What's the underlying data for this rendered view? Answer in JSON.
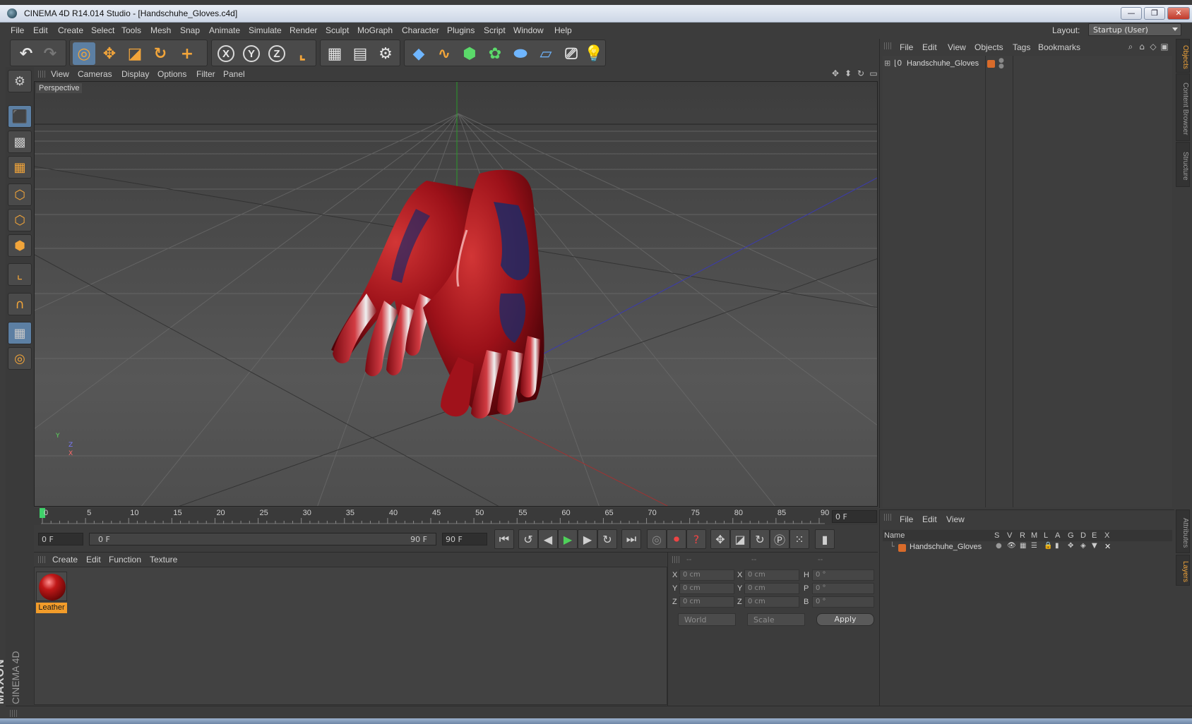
{
  "window": {
    "title": "CINEMA 4D R14.014 Studio - [Handschuhe_Gloves.c4d]",
    "minimize": "—",
    "restore": "❐",
    "close": "✕"
  },
  "menu": [
    "File",
    "Edit",
    "Create",
    "Select",
    "Tools",
    "Mesh",
    "Snap",
    "Animate",
    "Simulate",
    "Render",
    "Sculpt",
    "MoGraph",
    "Character",
    "Plugins",
    "Script",
    "Window",
    "Help"
  ],
  "layout": {
    "label": "Layout:",
    "value": "Startup (User)"
  },
  "toolbar": {
    "axis_x": "X",
    "axis_y": "Y",
    "axis_z": "Z"
  },
  "viewport": {
    "menu": [
      "View",
      "Cameras",
      "Display",
      "Options",
      "Filter",
      "Panel"
    ],
    "label": "Perspective",
    "axis_y": "Y",
    "axis_z": "Z",
    "axis_x": "X"
  },
  "timeline": {
    "ticks": [
      "0",
      "5",
      "10",
      "15",
      "20",
      "25",
      "30",
      "35",
      "40",
      "45",
      "50",
      "55",
      "60",
      "65",
      "70",
      "75",
      "80",
      "85",
      "90"
    ],
    "current_frame": "0 F"
  },
  "playbar": {
    "start_field": "0 F",
    "range_start": "0 F",
    "range_end": "90 F",
    "end_field": "90 F"
  },
  "materials": {
    "menu": [
      "Create",
      "Edit",
      "Function",
      "Texture"
    ],
    "items": [
      {
        "name": "Leather"
      }
    ]
  },
  "coordinates": {
    "headers": [
      "--",
      "--",
      "--"
    ],
    "rows": [
      {
        "l1": "X",
        "v1": "0 cm",
        "l2": "X",
        "v2": "0 cm",
        "l3": "H",
        "v3": "0 °"
      },
      {
        "l1": "Y",
        "v1": "0 cm",
        "l2": "Y",
        "v2": "0 cm",
        "l3": "P",
        "v3": "0 °"
      },
      {
        "l1": "Z",
        "v1": "0 cm",
        "l2": "Z",
        "v2": "0 cm",
        "l3": "B",
        "v3": "0 °"
      }
    ],
    "space": "World",
    "mode": "Scale",
    "apply": "Apply"
  },
  "objects": {
    "menu": [
      "File",
      "Edit",
      "View",
      "Objects",
      "Tags",
      "Bookmarks"
    ],
    "items": [
      {
        "name": "Handschuhe_Gloves"
      }
    ],
    "side_tabs": [
      "Objects",
      "Content Browser",
      "Structure"
    ]
  },
  "layers": {
    "menu": [
      "File",
      "Edit",
      "View"
    ],
    "columns": [
      "Name",
      "S",
      "V",
      "R",
      "M",
      "L",
      "A",
      "G",
      "D",
      "E",
      "X"
    ],
    "items": [
      {
        "name": "Handschuhe_Gloves"
      }
    ],
    "side_tabs": [
      "Attributes",
      "Layers"
    ]
  },
  "colors": {
    "accent": "#f29c2a",
    "active_tool": "#5c7fa3",
    "glove_red": "#a0121b",
    "glove_blue": "#1f2a66"
  }
}
